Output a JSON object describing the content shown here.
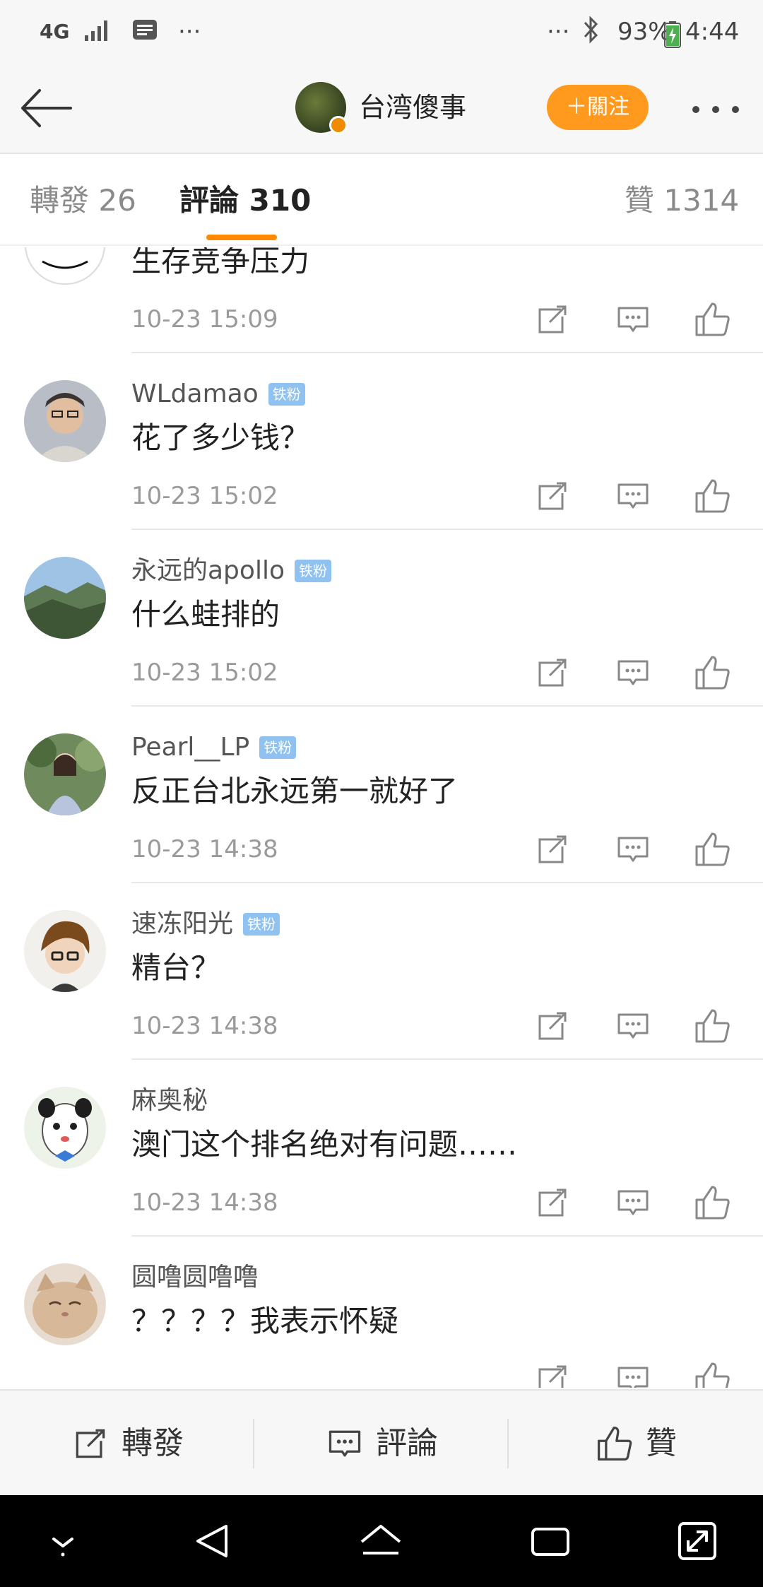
{
  "status_bar": {
    "network": "4G",
    "dots_left": "···",
    "dots_right": "···",
    "battery": "93%",
    "time": "4:44"
  },
  "header": {
    "title": "台湾傻事",
    "follow_label": "＋關注"
  },
  "tabs": {
    "repost": "轉發 26",
    "comment": "評論 310",
    "like": "贊 1314"
  },
  "comments": [
    {
      "name": "",
      "badge": "",
      "text": "生存竞争压力",
      "time": "10-23 15:09"
    },
    {
      "name": "WLdamao",
      "badge": "铁粉",
      "text": "花了多少钱？",
      "time": "10-23 15:02"
    },
    {
      "name": "永远的apollo",
      "badge": "铁粉",
      "text": "什么蛙排的",
      "time": "10-23 15:02"
    },
    {
      "name": "Pearl__LP",
      "badge": "铁粉",
      "text": "反正台北永远第一就好了",
      "time": "10-23 14:38"
    },
    {
      "name": "速冻阳光",
      "badge": "铁粉",
      "text": "精台？",
      "time": "10-23 14:38"
    },
    {
      "name": "麻奥秘",
      "badge": "",
      "text": "澳门这个排名绝对有问题……",
      "time": "10-23 14:38"
    },
    {
      "name": "圆噜圆噜噜",
      "badge": "",
      "text": "？？？？我表示怀疑",
      "time": ""
    }
  ],
  "bottom_bar": {
    "repost_label": "轉發",
    "comment_label": "評論",
    "like_label": "贊"
  },
  "colors": {
    "accent": "#ff9a1e",
    "badge": "#8fc2f0",
    "tab_indicator": "#ff8a00"
  }
}
